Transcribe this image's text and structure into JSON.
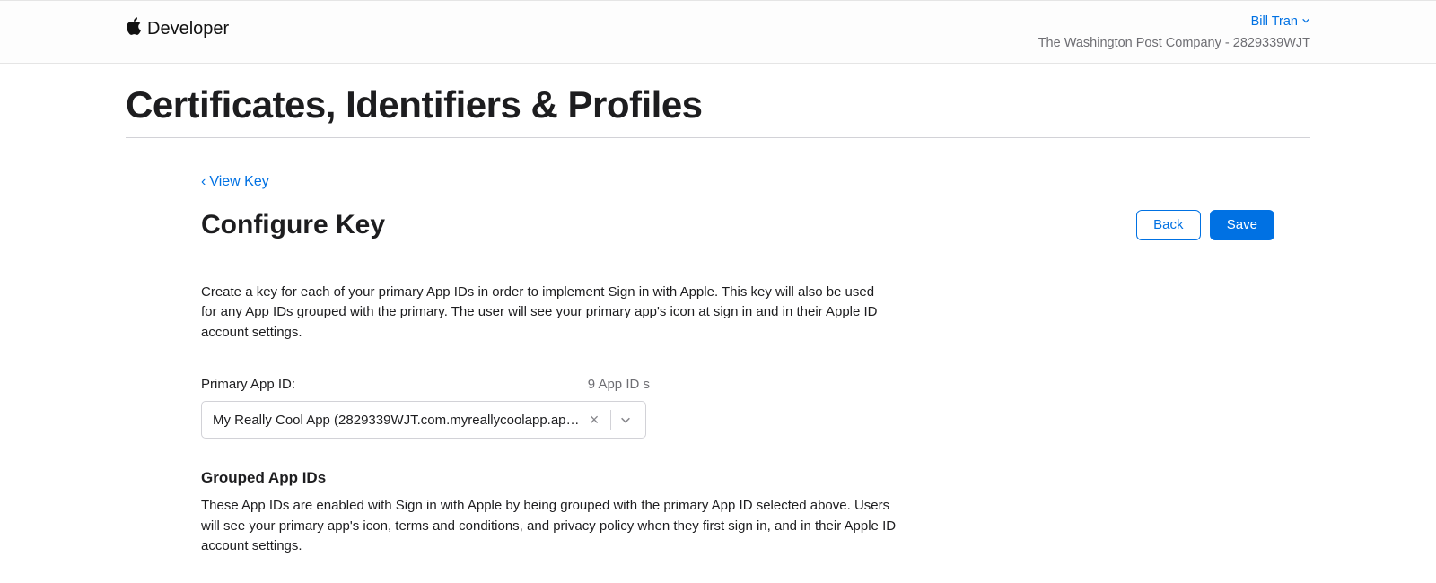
{
  "header": {
    "brand": "Developer",
    "user_name": "Bill Tran",
    "org_line": "The Washington Post Company - 2829339WJT"
  },
  "page_title": "Certificates, Identifiers & Profiles",
  "back_link": "View Key",
  "section": {
    "title": "Configure Key",
    "back_button": "Back",
    "save_button": "Save",
    "description": "Create a key for each of your primary App IDs in order to implement Sign in with Apple. This key will also be used for any App IDs grouped with the primary. The user will see your primary app's icon at sign in and in their Apple ID account settings."
  },
  "primary_app": {
    "label": "Primary App ID:",
    "count_text": "9 App ID s",
    "selected_value": "My Really Cool App (2829339WJT.com.myreallycoolapp.ap…"
  },
  "grouped": {
    "title": "Grouped App IDs",
    "description": "These App IDs are enabled with Sign in with Apple by being grouped with the primary App ID selected above. Users will see your primary app's icon, terms and conditions, and privacy policy when they first sign in, and in their Apple ID account settings."
  }
}
